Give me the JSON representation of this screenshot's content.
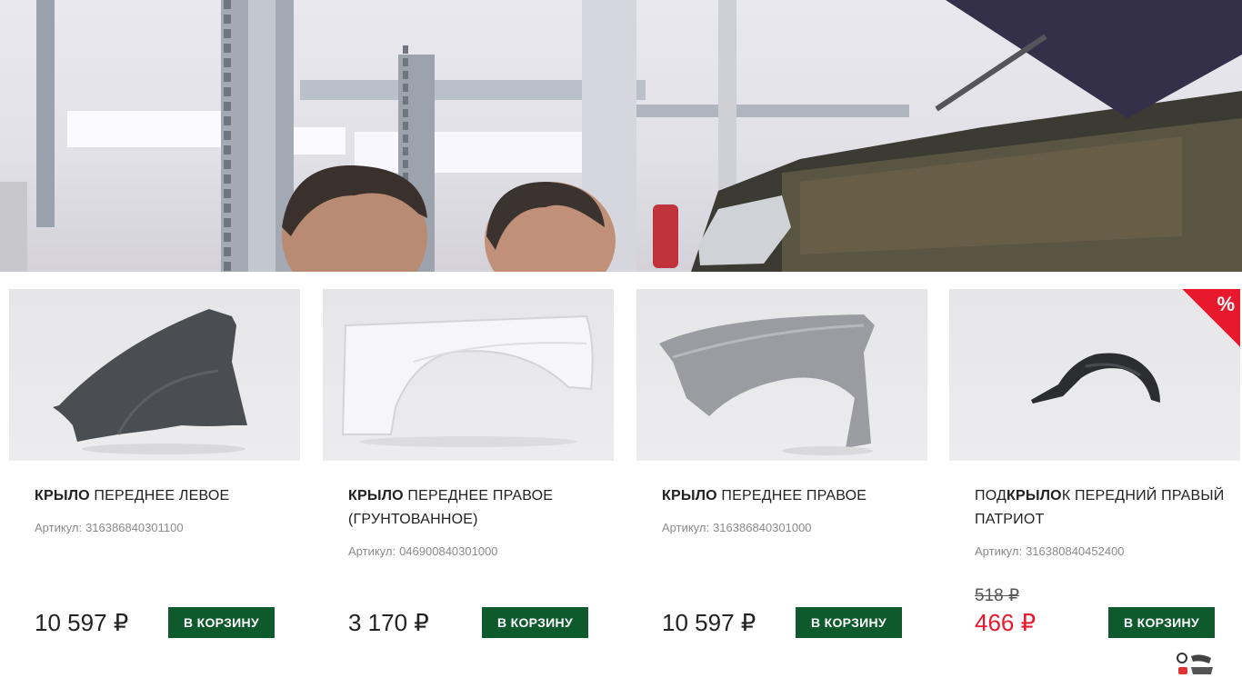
{
  "products": [
    {
      "title_bold": "КРЫЛО",
      "title_rest": " ПЕРЕДНЕЕ ЛЕВОЕ",
      "sku_label": "Артикул:",
      "sku": "316386840301100",
      "price": "10 597 ₽",
      "old_price": "",
      "sale": false,
      "button_label": "В КОРЗИНУ",
      "image_icon": "fender-left-dark-icon"
    },
    {
      "title_bold": "КРЫЛО",
      "title_rest": " ПЕРЕДНЕЕ ПРАВОЕ (ГРУНТОВАННОЕ)",
      "sku_label": "Артикул:",
      "sku": "046900840301000",
      "price": "3 170 ₽",
      "old_price": "",
      "sale": false,
      "button_label": "В КОРЗИНУ",
      "image_icon": "fender-white-primed-icon"
    },
    {
      "title_bold": "КРЫЛО",
      "title_rest": " ПЕРЕДНЕЕ ПРАВОЕ",
      "sku_label": "Артикул:",
      "sku": "316386840301000",
      "price": "10 597 ₽",
      "old_price": "",
      "sale": false,
      "button_label": "В КОРЗИНУ",
      "image_icon": "fender-right-grey-icon"
    },
    {
      "title_pre": "ПОД",
      "title_bold": "КРЫЛО",
      "title_rest": "К ПЕРЕДНИЙ ПРАВЫЙ ПАТРИОТ",
      "sku_label": "Артикул:",
      "sku": "316380840452400",
      "price": "466 ₽",
      "old_price": "518 ₽",
      "sale": true,
      "sale_badge": "%",
      "button_label": "В КОРЗИНУ",
      "image_icon": "wheel-arch-liner-icon"
    }
  ],
  "colors": {
    "button_bg": "#0f5a2d",
    "sale_red": "#e8192c",
    "sku_grey": "#8a8a8a"
  },
  "hero": {
    "image_icon": "garage-mechanics-photo"
  },
  "watermark": {
    "image_icon": "channel-logo-watermark"
  }
}
